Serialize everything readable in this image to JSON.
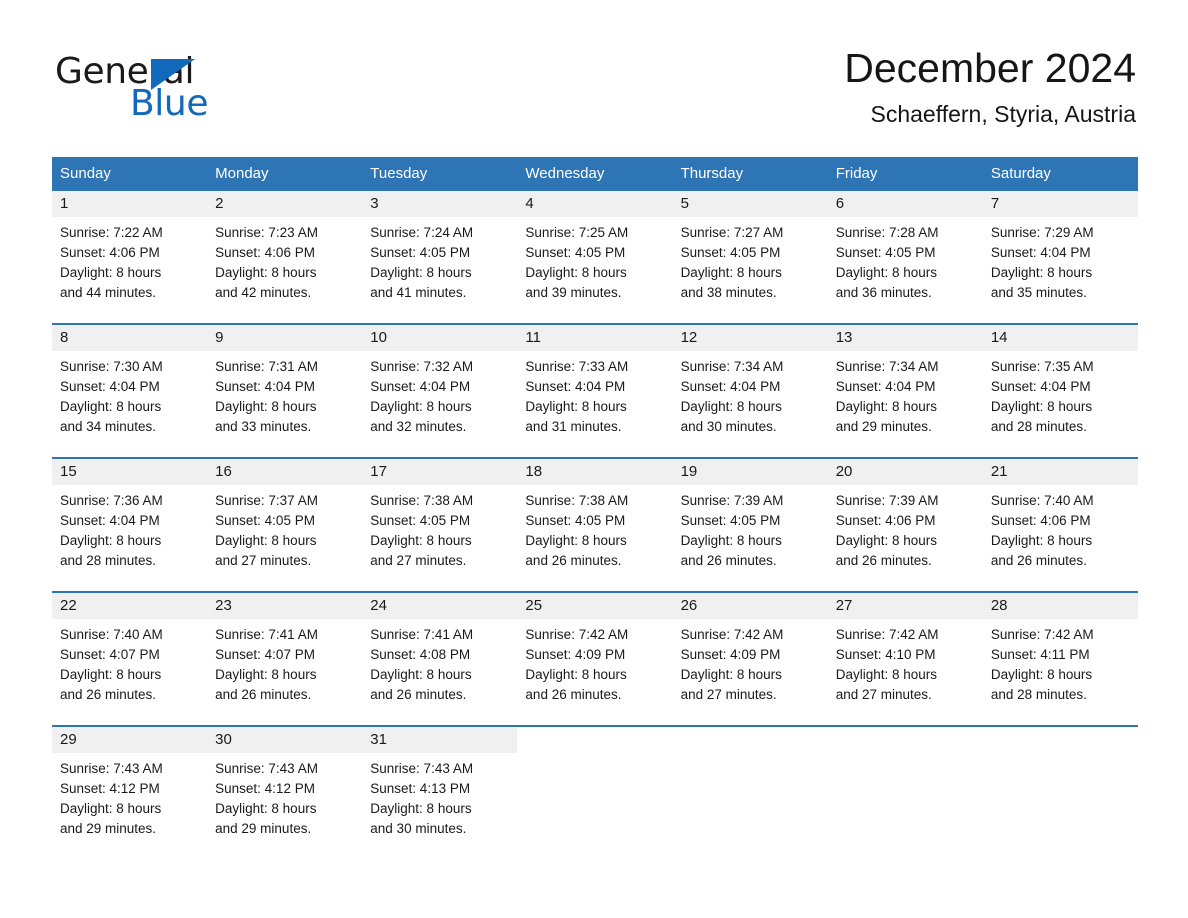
{
  "brand": {
    "name_part1": "General",
    "name_part2": "Blue",
    "triangle_icon": "triangle-icon",
    "accent_color": "#1169ba"
  },
  "header": {
    "title": "December 2024",
    "subtitle": "Schaeffern, Styria, Austria"
  },
  "theme": {
    "header_row_bg": "#2e75b6",
    "row_divider": "#2e75b6",
    "daynum_band_bg": "#f0f0f0",
    "text_color": "#1a1a1a",
    "page_bg": "#ffffff"
  },
  "weekdays": [
    "Sunday",
    "Monday",
    "Tuesday",
    "Wednesday",
    "Thursday",
    "Friday",
    "Saturday"
  ],
  "weeks": [
    [
      {
        "day": "1",
        "sunrise": "Sunrise: 7:22 AM",
        "sunset": "Sunset: 4:06 PM",
        "daylight1": "Daylight: 8 hours",
        "daylight2": "and 44 minutes."
      },
      {
        "day": "2",
        "sunrise": "Sunrise: 7:23 AM",
        "sunset": "Sunset: 4:06 PM",
        "daylight1": "Daylight: 8 hours",
        "daylight2": "and 42 minutes."
      },
      {
        "day": "3",
        "sunrise": "Sunrise: 7:24 AM",
        "sunset": "Sunset: 4:05 PM",
        "daylight1": "Daylight: 8 hours",
        "daylight2": "and 41 minutes."
      },
      {
        "day": "4",
        "sunrise": "Sunrise: 7:25 AM",
        "sunset": "Sunset: 4:05 PM",
        "daylight1": "Daylight: 8 hours",
        "daylight2": "and 39 minutes."
      },
      {
        "day": "5",
        "sunrise": "Sunrise: 7:27 AM",
        "sunset": "Sunset: 4:05 PM",
        "daylight1": "Daylight: 8 hours",
        "daylight2": "and 38 minutes."
      },
      {
        "day": "6",
        "sunrise": "Sunrise: 7:28 AM",
        "sunset": "Sunset: 4:05 PM",
        "daylight1": "Daylight: 8 hours",
        "daylight2": "and 36 minutes."
      },
      {
        "day": "7",
        "sunrise": "Sunrise: 7:29 AM",
        "sunset": "Sunset: 4:04 PM",
        "daylight1": "Daylight: 8 hours",
        "daylight2": "and 35 minutes."
      }
    ],
    [
      {
        "day": "8",
        "sunrise": "Sunrise: 7:30 AM",
        "sunset": "Sunset: 4:04 PM",
        "daylight1": "Daylight: 8 hours",
        "daylight2": "and 34 minutes."
      },
      {
        "day": "9",
        "sunrise": "Sunrise: 7:31 AM",
        "sunset": "Sunset: 4:04 PM",
        "daylight1": "Daylight: 8 hours",
        "daylight2": "and 33 minutes."
      },
      {
        "day": "10",
        "sunrise": "Sunrise: 7:32 AM",
        "sunset": "Sunset: 4:04 PM",
        "daylight1": "Daylight: 8 hours",
        "daylight2": "and 32 minutes."
      },
      {
        "day": "11",
        "sunrise": "Sunrise: 7:33 AM",
        "sunset": "Sunset: 4:04 PM",
        "daylight1": "Daylight: 8 hours",
        "daylight2": "and 31 minutes."
      },
      {
        "day": "12",
        "sunrise": "Sunrise: 7:34 AM",
        "sunset": "Sunset: 4:04 PM",
        "daylight1": "Daylight: 8 hours",
        "daylight2": "and 30 minutes."
      },
      {
        "day": "13",
        "sunrise": "Sunrise: 7:34 AM",
        "sunset": "Sunset: 4:04 PM",
        "daylight1": "Daylight: 8 hours",
        "daylight2": "and 29 minutes."
      },
      {
        "day": "14",
        "sunrise": "Sunrise: 7:35 AM",
        "sunset": "Sunset: 4:04 PM",
        "daylight1": "Daylight: 8 hours",
        "daylight2": "and 28 minutes."
      }
    ],
    [
      {
        "day": "15",
        "sunrise": "Sunrise: 7:36 AM",
        "sunset": "Sunset: 4:04 PM",
        "daylight1": "Daylight: 8 hours",
        "daylight2": "and 28 minutes."
      },
      {
        "day": "16",
        "sunrise": "Sunrise: 7:37 AM",
        "sunset": "Sunset: 4:05 PM",
        "daylight1": "Daylight: 8 hours",
        "daylight2": "and 27 minutes."
      },
      {
        "day": "17",
        "sunrise": "Sunrise: 7:38 AM",
        "sunset": "Sunset: 4:05 PM",
        "daylight1": "Daylight: 8 hours",
        "daylight2": "and 27 minutes."
      },
      {
        "day": "18",
        "sunrise": "Sunrise: 7:38 AM",
        "sunset": "Sunset: 4:05 PM",
        "daylight1": "Daylight: 8 hours",
        "daylight2": "and 26 minutes."
      },
      {
        "day": "19",
        "sunrise": "Sunrise: 7:39 AM",
        "sunset": "Sunset: 4:05 PM",
        "daylight1": "Daylight: 8 hours",
        "daylight2": "and 26 minutes."
      },
      {
        "day": "20",
        "sunrise": "Sunrise: 7:39 AM",
        "sunset": "Sunset: 4:06 PM",
        "daylight1": "Daylight: 8 hours",
        "daylight2": "and 26 minutes."
      },
      {
        "day": "21",
        "sunrise": "Sunrise: 7:40 AM",
        "sunset": "Sunset: 4:06 PM",
        "daylight1": "Daylight: 8 hours",
        "daylight2": "and 26 minutes."
      }
    ],
    [
      {
        "day": "22",
        "sunrise": "Sunrise: 7:40 AM",
        "sunset": "Sunset: 4:07 PM",
        "daylight1": "Daylight: 8 hours",
        "daylight2": "and 26 minutes."
      },
      {
        "day": "23",
        "sunrise": "Sunrise: 7:41 AM",
        "sunset": "Sunset: 4:07 PM",
        "daylight1": "Daylight: 8 hours",
        "daylight2": "and 26 minutes."
      },
      {
        "day": "24",
        "sunrise": "Sunrise: 7:41 AM",
        "sunset": "Sunset: 4:08 PM",
        "daylight1": "Daylight: 8 hours",
        "daylight2": "and 26 minutes."
      },
      {
        "day": "25",
        "sunrise": "Sunrise: 7:42 AM",
        "sunset": "Sunset: 4:09 PM",
        "daylight1": "Daylight: 8 hours",
        "daylight2": "and 26 minutes."
      },
      {
        "day": "26",
        "sunrise": "Sunrise: 7:42 AM",
        "sunset": "Sunset: 4:09 PM",
        "daylight1": "Daylight: 8 hours",
        "daylight2": "and 27 minutes."
      },
      {
        "day": "27",
        "sunrise": "Sunrise: 7:42 AM",
        "sunset": "Sunset: 4:10 PM",
        "daylight1": "Daylight: 8 hours",
        "daylight2": "and 27 minutes."
      },
      {
        "day": "28",
        "sunrise": "Sunrise: 7:42 AM",
        "sunset": "Sunset: 4:11 PM",
        "daylight1": "Daylight: 8 hours",
        "daylight2": "and 28 minutes."
      }
    ],
    [
      {
        "day": "29",
        "sunrise": "Sunrise: 7:43 AM",
        "sunset": "Sunset: 4:12 PM",
        "daylight1": "Daylight: 8 hours",
        "daylight2": "and 29 minutes."
      },
      {
        "day": "30",
        "sunrise": "Sunrise: 7:43 AM",
        "sunset": "Sunset: 4:12 PM",
        "daylight1": "Daylight: 8 hours",
        "daylight2": "and 29 minutes."
      },
      {
        "day": "31",
        "sunrise": "Sunrise: 7:43 AM",
        "sunset": "Sunset: 4:13 PM",
        "daylight1": "Daylight: 8 hours",
        "daylight2": "and 30 minutes."
      },
      {
        "day": "",
        "sunrise": "",
        "sunset": "",
        "daylight1": "",
        "daylight2": ""
      },
      {
        "day": "",
        "sunrise": "",
        "sunset": "",
        "daylight1": "",
        "daylight2": ""
      },
      {
        "day": "",
        "sunrise": "",
        "sunset": "",
        "daylight1": "",
        "daylight2": ""
      },
      {
        "day": "",
        "sunrise": "",
        "sunset": "",
        "daylight1": "",
        "daylight2": ""
      }
    ]
  ]
}
